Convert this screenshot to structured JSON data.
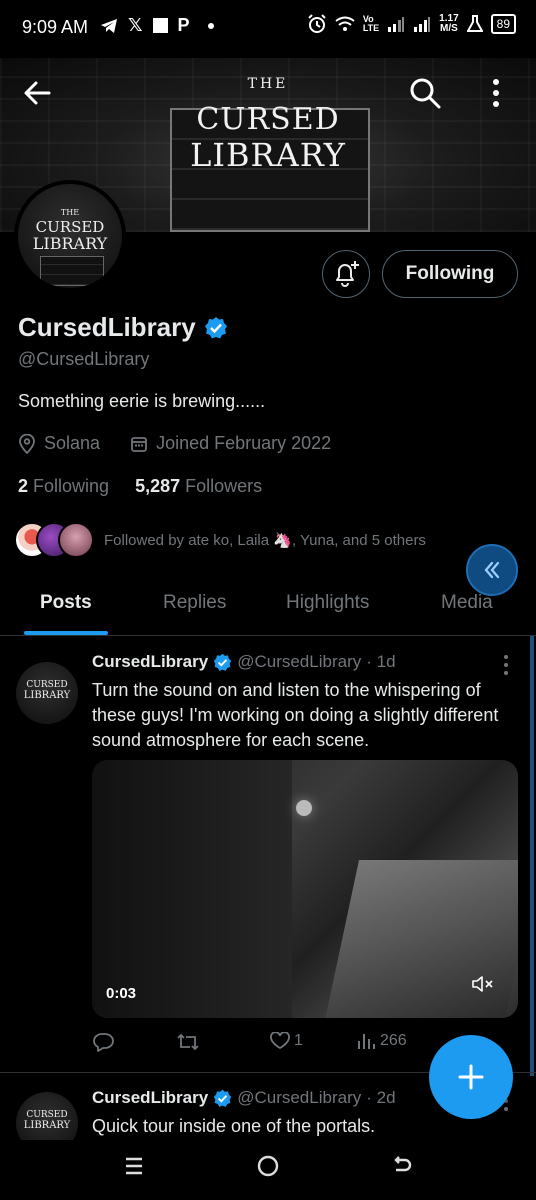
{
  "status_bar": {
    "time": "9:09 AM",
    "battery": "89",
    "net_speed_top": "1.17",
    "net_speed_unit": "M/S",
    "left_icons": [
      "telegram-icon",
      "x-icon",
      "square-icon",
      "p-icon",
      "dot-icon"
    ],
    "right_icons": [
      "alarm-icon",
      "wifi-icon",
      "volte-icon",
      "signal-icon",
      "signal-icon",
      "flask-icon",
      "battery-icon"
    ],
    "volte_top": "Vo",
    "volte_bottom": "LTE"
  },
  "banner": {
    "the": "THE",
    "line1": "CURSED",
    "line2": "LIBRARY"
  },
  "avatar": {
    "the": "THE",
    "line1": "CURSED",
    "line2": "LIBRARY"
  },
  "profile": {
    "display_name": "CursedLibrary",
    "handle": "@CursedLibrary",
    "bio": "Something eerie is brewing......",
    "location": "Solana",
    "joined": "Joined February 2022",
    "following_count": "2",
    "following_label": "Following",
    "followers_count": "5,287",
    "followers_label": "Followers",
    "followed_by": "Followed by ate ko, Laila 🦄, Yuna, and 5 others",
    "follow_button": "Following"
  },
  "tabs": [
    {
      "label": "Posts",
      "active": true
    },
    {
      "label": "Replies",
      "active": false
    },
    {
      "label": "Highlights",
      "active": false
    },
    {
      "label": "Media",
      "active": false
    }
  ],
  "posts": [
    {
      "name": "CursedLibrary",
      "handle": "@CursedLibrary",
      "time": "· 1d",
      "text": "Turn the sound on and listen to the whispering of these guys! I'm working on doing a slightly different sound atmosphere for each scene.",
      "video_time": "0:03",
      "likes": "1",
      "views": "266",
      "avatar_line1": "CURSED",
      "avatar_line2": "LIBRARY"
    },
    {
      "name": "CursedLibrary",
      "handle": "@CursedLibrary",
      "time": "· 2d",
      "text": "Quick tour inside one of the portals.",
      "avatar_line1": "CURSED",
      "avatar_line2": "LIBRARY"
    }
  ],
  "colors": {
    "accent": "#1d9bf0",
    "muted": "#71767b",
    "text": "#e7e9ea",
    "border": "#2f3336"
  }
}
